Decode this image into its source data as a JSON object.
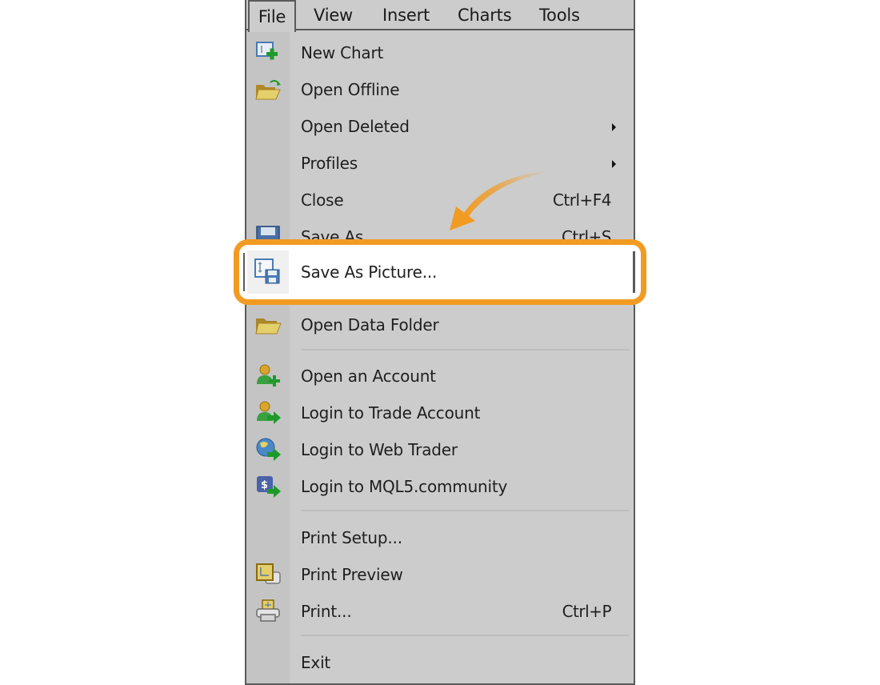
{
  "menubar": {
    "items": [
      {
        "label": "File",
        "active": true
      },
      {
        "label": "View"
      },
      {
        "label": "Insert"
      },
      {
        "label": "Charts"
      },
      {
        "label": "Tools"
      }
    ]
  },
  "file_menu": {
    "items": [
      {
        "label": "New Chart",
        "icon": "new-chart-icon"
      },
      {
        "label": "Open Offline",
        "icon": "open-offline-folder-icon"
      },
      {
        "label": "Open Deleted",
        "submenu": true
      },
      {
        "label": "Profiles",
        "submenu": true
      },
      {
        "label": "Close",
        "shortcut": "Ctrl+F4"
      },
      {
        "label": "Save As",
        "shortcut": "Ctrl+S",
        "icon": "save-icon"
      },
      {
        "label": "Save As Picture...",
        "icon": "save-picture-icon",
        "highlighted": true
      },
      {
        "label": "Open Data Folder",
        "icon": "folder-icon"
      },
      {
        "label": "Open an Account",
        "icon": "add-user-icon"
      },
      {
        "label": "Login to Trade Account",
        "icon": "user-login-icon"
      },
      {
        "label": "Login to Web Trader",
        "icon": "globe-login-icon"
      },
      {
        "label": "Login to MQL5.community",
        "icon": "mql5-login-icon"
      },
      {
        "label": "Print Setup..."
      },
      {
        "label": "Print Preview",
        "icon": "print-preview-icon"
      },
      {
        "label": "Print...",
        "shortcut": "Ctrl+P",
        "icon": "printer-icon"
      },
      {
        "label": "Exit"
      }
    ]
  },
  "annotation": {
    "highlight_color": "#f29b23",
    "target": "Save As Picture..."
  }
}
